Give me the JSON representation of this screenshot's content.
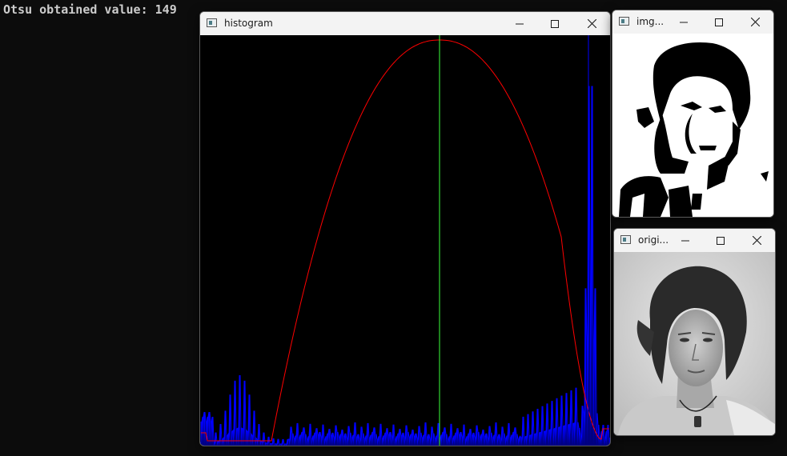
{
  "console": {
    "text": "Otsu obtained value: 149"
  },
  "windows": {
    "histogram": {
      "title": "histogram"
    },
    "img": {
      "title": "img..."
    },
    "original": {
      "title": "origi..."
    }
  },
  "caption_icons": {
    "minimize": "minimize-icon",
    "maximize": "maximize-icon",
    "close": "close-icon"
  },
  "chart_data": {
    "type": "line",
    "threshold": 149,
    "xlim": [
      0,
      255
    ],
    "series": [
      {
        "color": "#ff0000"
      },
      {
        "color": "#0000ff"
      }
    ],
    "threshold_color": "#3cff3c"
  }
}
